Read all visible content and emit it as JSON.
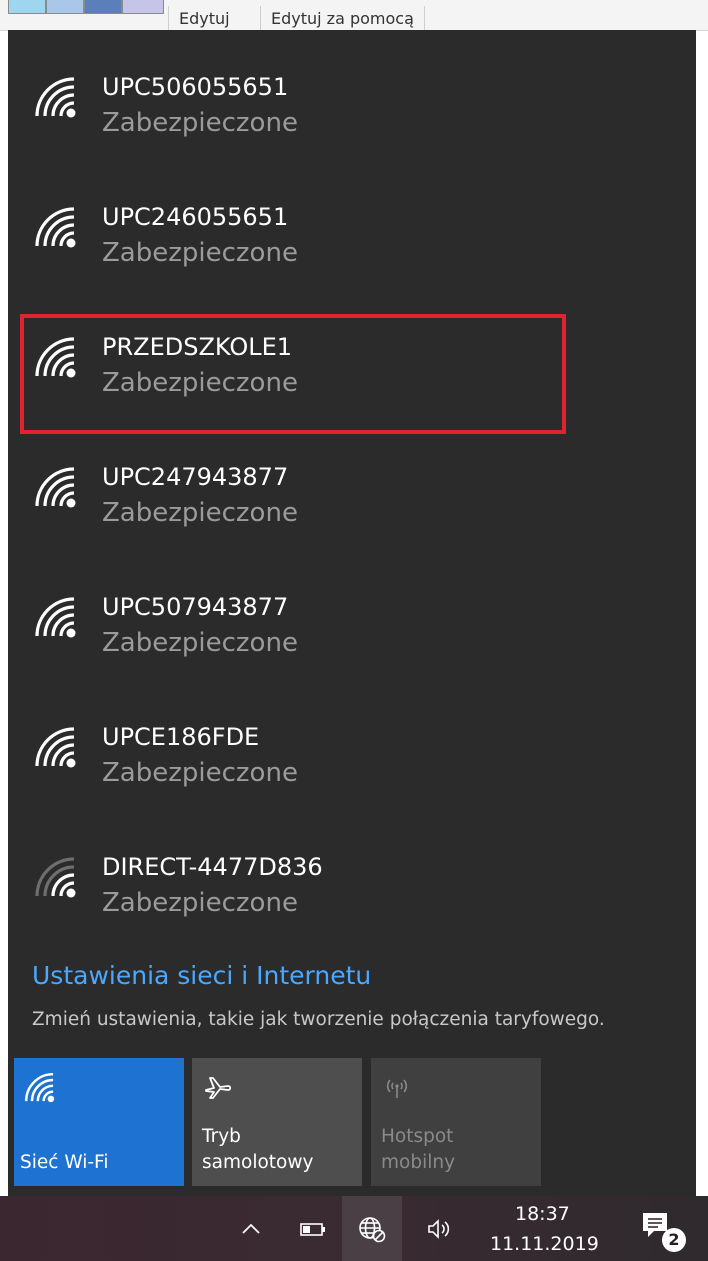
{
  "underlying_app": {
    "tabs": [
      "Edytuj",
      "Edytuj za pomocą"
    ]
  },
  "networks": [
    {
      "name": "UPC506055651",
      "status": "Zabezpieczone",
      "icon": "wifi-full-icon",
      "highlighted": false
    },
    {
      "name": "UPC246055651",
      "status": "Zabezpieczone",
      "icon": "wifi-full-icon",
      "highlighted": false
    },
    {
      "name": "PRZEDSZKOLE1",
      "status": "Zabezpieczone",
      "icon": "wifi-full-icon",
      "highlighted": true
    },
    {
      "name": "UPC247943877",
      "status": "Zabezpieczone",
      "icon": "wifi-full-icon",
      "highlighted": false
    },
    {
      "name": "UPC507943877",
      "status": "Zabezpieczone",
      "icon": "wifi-full-icon",
      "highlighted": false
    },
    {
      "name": "UPCE186FDE",
      "status": "Zabezpieczone",
      "icon": "wifi-full-icon",
      "highlighted": false
    },
    {
      "name": "DIRECT-4477D836",
      "status": "Zabezpieczone",
      "icon": "wifi-weak-icon",
      "highlighted": false
    }
  ],
  "settings": {
    "link": "Ustawienia sieci i Internetu",
    "description": "Zmień ustawienia, takie jak tworzenie połączenia taryfowego."
  },
  "quick_actions": {
    "wifi": {
      "label": "Sieć Wi-Fi",
      "active": true
    },
    "airplane": {
      "label_line1": "Tryb",
      "label_line2": "samolotowy",
      "active": false
    },
    "hotspot": {
      "label_line1": "Hotspot",
      "label_line2": "mobilny",
      "disabled": true
    }
  },
  "taskbar": {
    "time": "18:37",
    "date": "11.11.2019",
    "notification_count": "2"
  },
  "colors": {
    "panel": "#2b2b2b",
    "accent": "#1e73d2",
    "link": "#4aa8ff",
    "highlight_border": "#e0232e"
  }
}
